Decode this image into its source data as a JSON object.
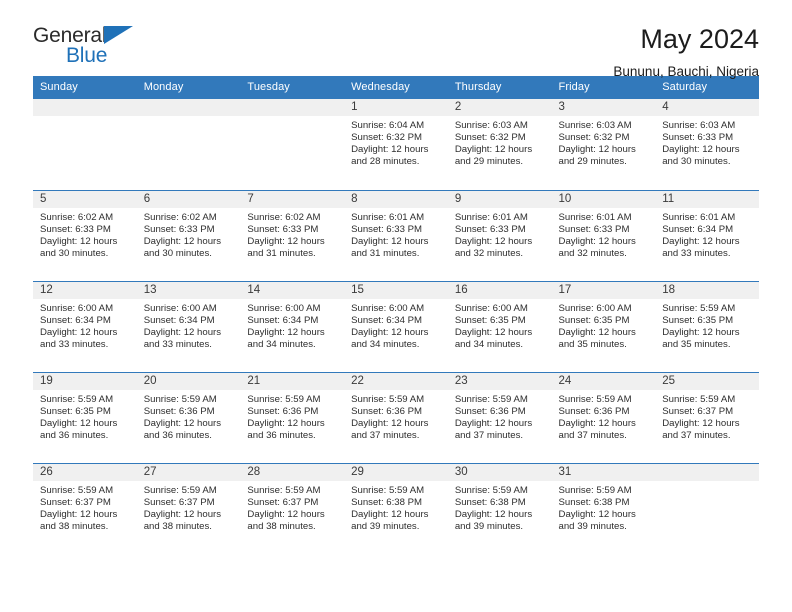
{
  "brand": {
    "name_top": "General",
    "name_bottom": "Blue",
    "accent_color": "#1f71b8"
  },
  "header": {
    "title": "May 2024",
    "subtitle": "Bununu, Bauchi, Nigeria"
  },
  "colors": {
    "header_row_bg": "#3279bb",
    "header_row_text": "#ffffff",
    "daynum_bar_bg": "#f0f0f0",
    "row_divider": "#3279bb",
    "page_bg": "#ffffff"
  },
  "calendar": {
    "weekday_headers": [
      "Sunday",
      "Monday",
      "Tuesday",
      "Wednesday",
      "Thursday",
      "Friday",
      "Saturday"
    ],
    "labels": {
      "sunrise": "Sunrise:",
      "sunset": "Sunset:",
      "daylight": "Daylight:"
    },
    "weeks": [
      [
        {
          "day": "",
          "empty": true
        },
        {
          "day": "",
          "empty": true
        },
        {
          "day": "",
          "empty": true
        },
        {
          "day": "1",
          "sunrise": "Sunrise: 6:04 AM",
          "sunset": "Sunset: 6:32 PM",
          "daylight_1": "Daylight: 12 hours",
          "daylight_2": "and 28 minutes."
        },
        {
          "day": "2",
          "sunrise": "Sunrise: 6:03 AM",
          "sunset": "Sunset: 6:32 PM",
          "daylight_1": "Daylight: 12 hours",
          "daylight_2": "and 29 minutes."
        },
        {
          "day": "3",
          "sunrise": "Sunrise: 6:03 AM",
          "sunset": "Sunset: 6:32 PM",
          "daylight_1": "Daylight: 12 hours",
          "daylight_2": "and 29 minutes."
        },
        {
          "day": "4",
          "sunrise": "Sunrise: 6:03 AM",
          "sunset": "Sunset: 6:33 PM",
          "daylight_1": "Daylight: 12 hours",
          "daylight_2": "and 30 minutes."
        }
      ],
      [
        {
          "day": "5",
          "sunrise": "Sunrise: 6:02 AM",
          "sunset": "Sunset: 6:33 PM",
          "daylight_1": "Daylight: 12 hours",
          "daylight_2": "and 30 minutes."
        },
        {
          "day": "6",
          "sunrise": "Sunrise: 6:02 AM",
          "sunset": "Sunset: 6:33 PM",
          "daylight_1": "Daylight: 12 hours",
          "daylight_2": "and 30 minutes."
        },
        {
          "day": "7",
          "sunrise": "Sunrise: 6:02 AM",
          "sunset": "Sunset: 6:33 PM",
          "daylight_1": "Daylight: 12 hours",
          "daylight_2": "and 31 minutes."
        },
        {
          "day": "8",
          "sunrise": "Sunrise: 6:01 AM",
          "sunset": "Sunset: 6:33 PM",
          "daylight_1": "Daylight: 12 hours",
          "daylight_2": "and 31 minutes."
        },
        {
          "day": "9",
          "sunrise": "Sunrise: 6:01 AM",
          "sunset": "Sunset: 6:33 PM",
          "daylight_1": "Daylight: 12 hours",
          "daylight_2": "and 32 minutes."
        },
        {
          "day": "10",
          "sunrise": "Sunrise: 6:01 AM",
          "sunset": "Sunset: 6:33 PM",
          "daylight_1": "Daylight: 12 hours",
          "daylight_2": "and 32 minutes."
        },
        {
          "day": "11",
          "sunrise": "Sunrise: 6:01 AM",
          "sunset": "Sunset: 6:34 PM",
          "daylight_1": "Daylight: 12 hours",
          "daylight_2": "and 33 minutes."
        }
      ],
      [
        {
          "day": "12",
          "sunrise": "Sunrise: 6:00 AM",
          "sunset": "Sunset: 6:34 PM",
          "daylight_1": "Daylight: 12 hours",
          "daylight_2": "and 33 minutes."
        },
        {
          "day": "13",
          "sunrise": "Sunrise: 6:00 AM",
          "sunset": "Sunset: 6:34 PM",
          "daylight_1": "Daylight: 12 hours",
          "daylight_2": "and 33 minutes."
        },
        {
          "day": "14",
          "sunrise": "Sunrise: 6:00 AM",
          "sunset": "Sunset: 6:34 PM",
          "daylight_1": "Daylight: 12 hours",
          "daylight_2": "and 34 minutes."
        },
        {
          "day": "15",
          "sunrise": "Sunrise: 6:00 AM",
          "sunset": "Sunset: 6:34 PM",
          "daylight_1": "Daylight: 12 hours",
          "daylight_2": "and 34 minutes."
        },
        {
          "day": "16",
          "sunrise": "Sunrise: 6:00 AM",
          "sunset": "Sunset: 6:35 PM",
          "daylight_1": "Daylight: 12 hours",
          "daylight_2": "and 34 minutes."
        },
        {
          "day": "17",
          "sunrise": "Sunrise: 6:00 AM",
          "sunset": "Sunset: 6:35 PM",
          "daylight_1": "Daylight: 12 hours",
          "daylight_2": "and 35 minutes."
        },
        {
          "day": "18",
          "sunrise": "Sunrise: 5:59 AM",
          "sunset": "Sunset: 6:35 PM",
          "daylight_1": "Daylight: 12 hours",
          "daylight_2": "and 35 minutes."
        }
      ],
      [
        {
          "day": "19",
          "sunrise": "Sunrise: 5:59 AM",
          "sunset": "Sunset: 6:35 PM",
          "daylight_1": "Daylight: 12 hours",
          "daylight_2": "and 36 minutes."
        },
        {
          "day": "20",
          "sunrise": "Sunrise: 5:59 AM",
          "sunset": "Sunset: 6:36 PM",
          "daylight_1": "Daylight: 12 hours",
          "daylight_2": "and 36 minutes."
        },
        {
          "day": "21",
          "sunrise": "Sunrise: 5:59 AM",
          "sunset": "Sunset: 6:36 PM",
          "daylight_1": "Daylight: 12 hours",
          "daylight_2": "and 36 minutes."
        },
        {
          "day": "22",
          "sunrise": "Sunrise: 5:59 AM",
          "sunset": "Sunset: 6:36 PM",
          "daylight_1": "Daylight: 12 hours",
          "daylight_2": "and 37 minutes."
        },
        {
          "day": "23",
          "sunrise": "Sunrise: 5:59 AM",
          "sunset": "Sunset: 6:36 PM",
          "daylight_1": "Daylight: 12 hours",
          "daylight_2": "and 37 minutes."
        },
        {
          "day": "24",
          "sunrise": "Sunrise: 5:59 AM",
          "sunset": "Sunset: 6:36 PM",
          "daylight_1": "Daylight: 12 hours",
          "daylight_2": "and 37 minutes."
        },
        {
          "day": "25",
          "sunrise": "Sunrise: 5:59 AM",
          "sunset": "Sunset: 6:37 PM",
          "daylight_1": "Daylight: 12 hours",
          "daylight_2": "and 37 minutes."
        }
      ],
      [
        {
          "day": "26",
          "sunrise": "Sunrise: 5:59 AM",
          "sunset": "Sunset: 6:37 PM",
          "daylight_1": "Daylight: 12 hours",
          "daylight_2": "and 38 minutes."
        },
        {
          "day": "27",
          "sunrise": "Sunrise: 5:59 AM",
          "sunset": "Sunset: 6:37 PM",
          "daylight_1": "Daylight: 12 hours",
          "daylight_2": "and 38 minutes."
        },
        {
          "day": "28",
          "sunrise": "Sunrise: 5:59 AM",
          "sunset": "Sunset: 6:37 PM",
          "daylight_1": "Daylight: 12 hours",
          "daylight_2": "and 38 minutes."
        },
        {
          "day": "29",
          "sunrise": "Sunrise: 5:59 AM",
          "sunset": "Sunset: 6:38 PM",
          "daylight_1": "Daylight: 12 hours",
          "daylight_2": "and 39 minutes."
        },
        {
          "day": "30",
          "sunrise": "Sunrise: 5:59 AM",
          "sunset": "Sunset: 6:38 PM",
          "daylight_1": "Daylight: 12 hours",
          "daylight_2": "and 39 minutes."
        },
        {
          "day": "31",
          "sunrise": "Sunrise: 5:59 AM",
          "sunset": "Sunset: 6:38 PM",
          "daylight_1": "Daylight: 12 hours",
          "daylight_2": "and 39 minutes."
        },
        {
          "day": "",
          "empty": true
        }
      ]
    ]
  }
}
